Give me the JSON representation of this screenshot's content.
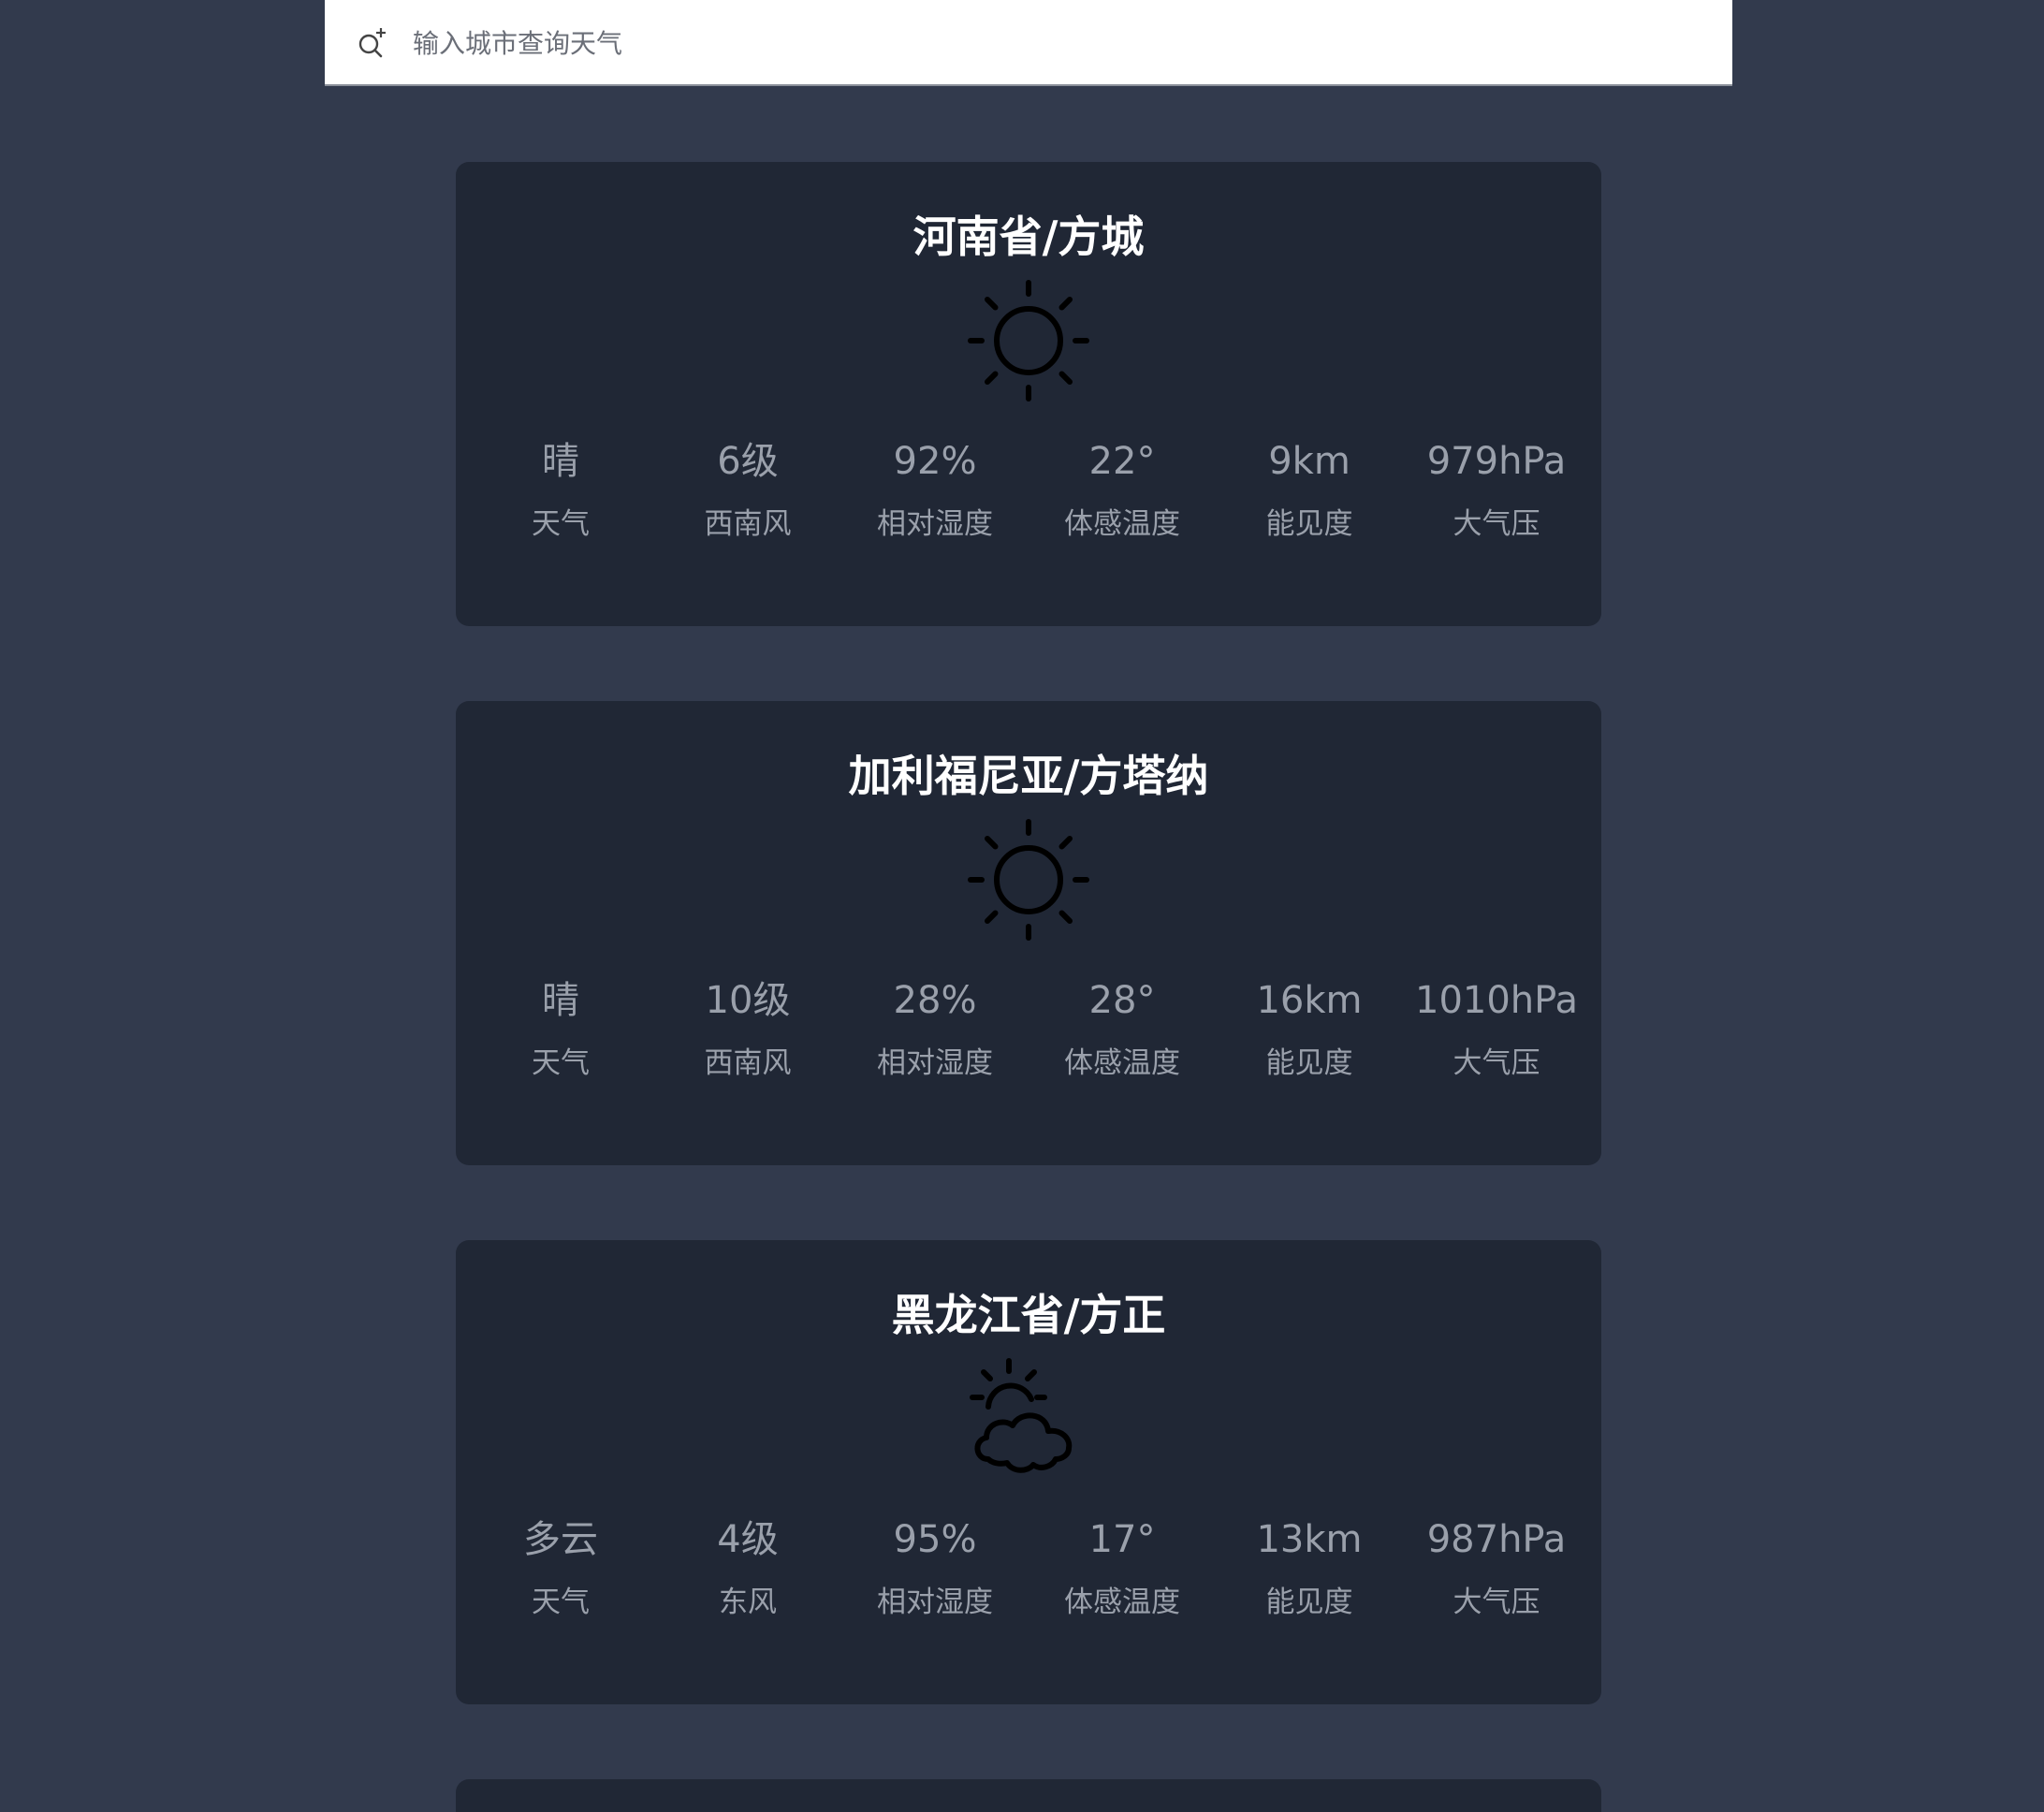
{
  "search": {
    "placeholder": "输入城市查询天气",
    "icon": "search-plus-icon"
  },
  "cards": [
    {
      "title": "河南省/方城",
      "icon": "sun-icon",
      "metrics": [
        {
          "value": "晴",
          "label": "天气"
        },
        {
          "value": "6级",
          "label": "西南风"
        },
        {
          "value": "92%",
          "label": "相对湿度"
        },
        {
          "value": "22°",
          "label": "体感温度"
        },
        {
          "value": "9km",
          "label": "能见度"
        },
        {
          "value": "979hPa",
          "label": "大气压"
        }
      ]
    },
    {
      "title": "加利福尼亚/方塔纳",
      "icon": "sun-icon",
      "metrics": [
        {
          "value": "晴",
          "label": "天气"
        },
        {
          "value": "10级",
          "label": "西南风"
        },
        {
          "value": "28%",
          "label": "相对湿度"
        },
        {
          "value": "28°",
          "label": "体感温度"
        },
        {
          "value": "16km",
          "label": "能见度"
        },
        {
          "value": "1010hPa",
          "label": "大气压"
        }
      ]
    },
    {
      "title": "黑龙江省/方正",
      "icon": "partly-cloudy-icon",
      "metrics": [
        {
          "value": "多云",
          "label": "天气"
        },
        {
          "value": "4级",
          "label": "东风"
        },
        {
          "value": "95%",
          "label": "相对湿度"
        },
        {
          "value": "17°",
          "label": "体感温度"
        },
        {
          "value": "13km",
          "label": "能见度"
        },
        {
          "value": "987hPa",
          "label": "大气压"
        }
      ]
    }
  ],
  "colors": {
    "background": "#323a4d",
    "card": "#202735",
    "title": "#ffffff",
    "metric_text": "#9aa0ab",
    "icon": "#000000"
  }
}
